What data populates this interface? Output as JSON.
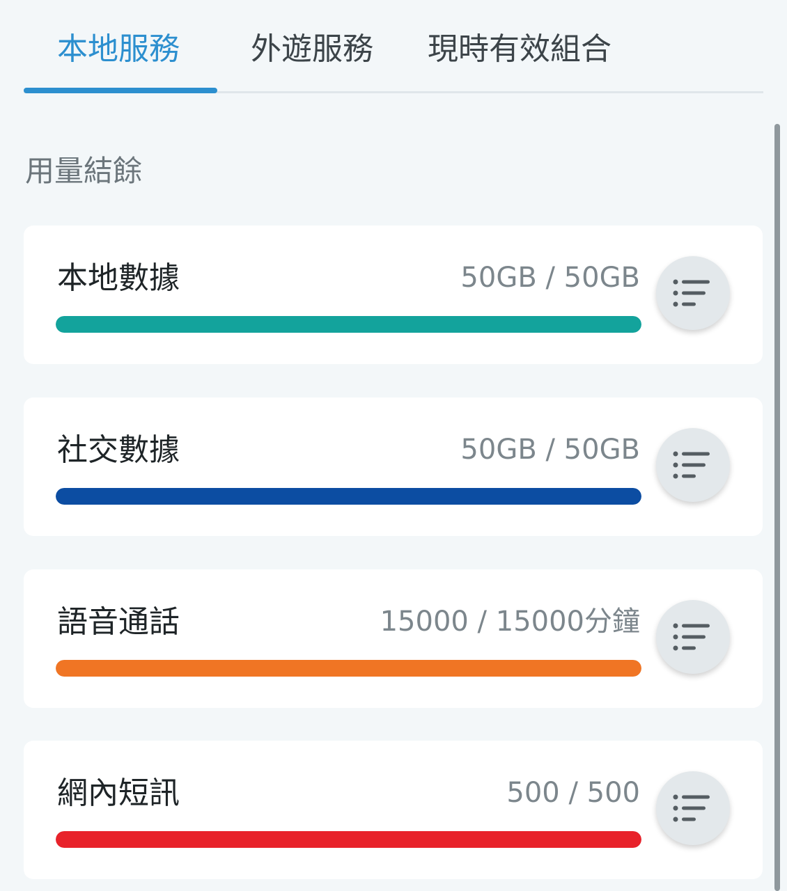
{
  "tabs": [
    {
      "label": "本地服務",
      "active": true
    },
    {
      "label": "外遊服務",
      "active": false
    },
    {
      "label": "現時有效組合",
      "active": false
    }
  ],
  "accent_color": "#2c8fcf",
  "section_title": "用量結餘",
  "usage": [
    {
      "name": "本地數據",
      "value_text": "50GB / 50GB",
      "remaining_fraction": 1.0,
      "color": "#13a39c",
      "icon": "list-icon"
    },
    {
      "name": "社交數據",
      "value_text": "50GB / 50GB",
      "remaining_fraction": 1.0,
      "color": "#0c4da2",
      "icon": "list-icon"
    },
    {
      "name": "語音通話",
      "value_text": "15000 / 15000分鐘",
      "remaining_fraction": 1.0,
      "color": "#f07524",
      "icon": "list-icon"
    },
    {
      "name": "網內短訊",
      "value_text": "500 / 500",
      "remaining_fraction": 1.0,
      "color": "#e8222a",
      "icon": "list-icon"
    }
  ]
}
